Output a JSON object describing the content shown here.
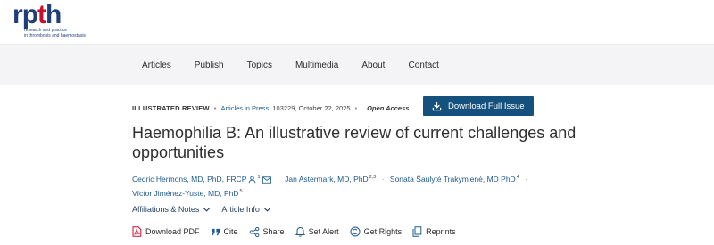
{
  "logo": {
    "letters": [
      "r",
      "p",
      "t",
      "h"
    ],
    "tagline_line1": "research and practice",
    "tagline_line2": "in thrombosis and haemostasis",
    "brand_color": "#1f3f7a",
    "accent_color": "#c8102e"
  },
  "nav": {
    "items": [
      "Articles",
      "Publish",
      "Topics",
      "Multimedia",
      "About",
      "Contact"
    ]
  },
  "meta": {
    "type": "ILLUSTRATED REVIEW",
    "sep": "•",
    "articles_in_press": "Articles in Press",
    "details": ", 103229, October 22, 2025",
    "open_access": "Open Access"
  },
  "download_full_issue": {
    "label": "Download Full Issue",
    "icon": "download-icon",
    "color": "#14517c"
  },
  "title": "Haemophilia B: An illustrative review of current challenges and opportunities",
  "authors": [
    {
      "name": "Cedric Hermons, MD, PhD, FRCP",
      "sup": "1"
    },
    {
      "name": "Jan Astermark, MD, PhD",
      "sup": "2,3"
    },
    {
      "name": "Sonata Šaulytė Trakymienė, MD PhD",
      "sup": "4"
    },
    {
      "name": "Víctor Jiménez-Yuste, MD, PhD",
      "sup": "5"
    }
  ],
  "author_sep": "·",
  "dropdowns": {
    "affiliations": "Affiliations & Notes",
    "article_info": "Article Info"
  },
  "actions": {
    "download_pdf": "Download PDF",
    "cite": "Cite",
    "share": "Share",
    "set_alert": "Set Alert",
    "get_rights": "Get Rights",
    "reprints": "Reprints"
  }
}
